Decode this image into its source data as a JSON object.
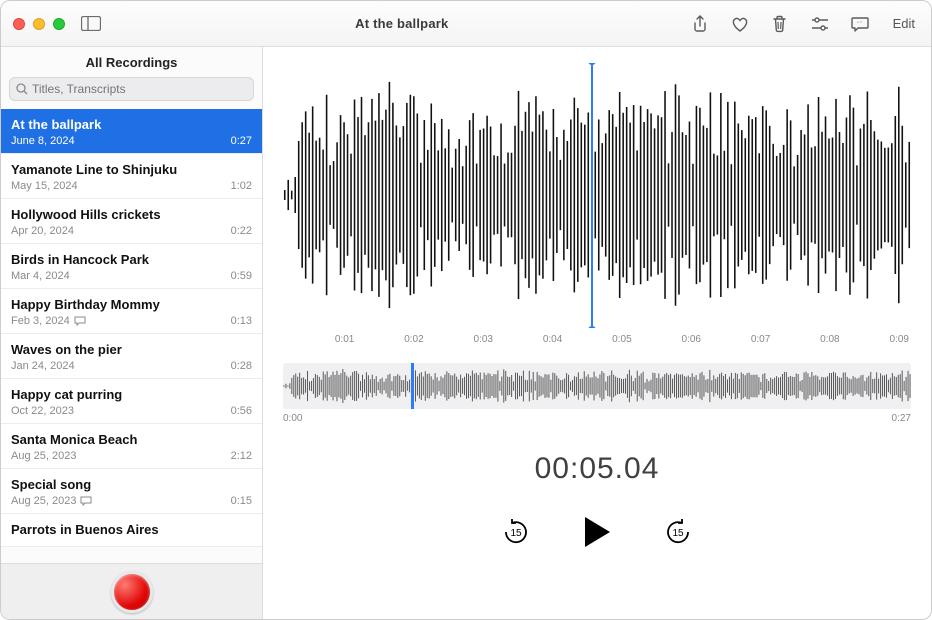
{
  "window": {
    "title": "At the ballpark"
  },
  "toolbar": {
    "edit_label": "Edit"
  },
  "sidebar": {
    "header": "All Recordings",
    "search_placeholder": "Titles, Transcripts",
    "recordings": [
      {
        "title": "At the ballpark",
        "date": "June 8, 2024",
        "duration": "0:27",
        "selected": true,
        "has_transcript": false
      },
      {
        "title": "Yamanote Line to Shinjuku",
        "date": "May 15, 2024",
        "duration": "1:02",
        "selected": false,
        "has_transcript": false
      },
      {
        "title": "Hollywood Hills crickets",
        "date": "Apr 20, 2024",
        "duration": "0:22",
        "selected": false,
        "has_transcript": false
      },
      {
        "title": "Birds in Hancock Park",
        "date": "Mar 4, 2024",
        "duration": "0:59",
        "selected": false,
        "has_transcript": false
      },
      {
        "title": "Happy Birthday Mommy",
        "date": "Feb 3, 2024",
        "duration": "0:13",
        "selected": false,
        "has_transcript": true
      },
      {
        "title": "Waves on the pier",
        "date": "Jan 24, 2024",
        "duration": "0:28",
        "selected": false,
        "has_transcript": false
      },
      {
        "title": "Happy cat purring",
        "date": "Oct 22, 2023",
        "duration": "0:56",
        "selected": false,
        "has_transcript": false
      },
      {
        "title": "Santa Monica Beach",
        "date": "Aug 25, 2023",
        "duration": "2:12",
        "selected": false,
        "has_transcript": false
      },
      {
        "title": "Special song",
        "date": "Aug 25, 2023",
        "duration": "0:15",
        "selected": false,
        "has_transcript": true
      },
      {
        "title": "Parrots in Buenos Aires",
        "date": "",
        "duration": "",
        "selected": false,
        "has_transcript": false
      }
    ]
  },
  "playback": {
    "tick_labels": [
      "",
      "0:01",
      "0:02",
      "0:03",
      "0:04",
      "0:05",
      "0:06",
      "0:07",
      "0:08",
      "0:09"
    ],
    "overview_start": "0:00",
    "overview_end": "0:27",
    "timecode": "00:05.04",
    "skip_seconds": "15"
  },
  "colors": {
    "accent": "#2f7bff",
    "selected_bg": "#1f6fe5",
    "record": "#e10707"
  }
}
